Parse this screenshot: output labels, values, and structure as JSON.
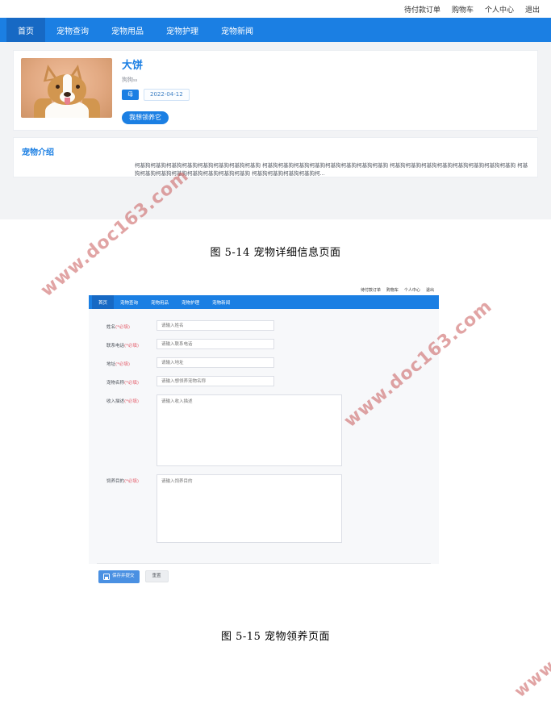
{
  "document": {
    "watermark_text": "www.doc163.com",
    "watermark_color": "#c85a5a"
  },
  "figure1": {
    "caption": "图 5-14  宠物详细信息页面",
    "topbar": {
      "items": [
        {
          "label": "待付款订单"
        },
        {
          "label": "购物车"
        },
        {
          "label": "个人中心"
        },
        {
          "label": "退出"
        }
      ]
    },
    "nav": {
      "items": [
        {
          "label": "首页",
          "active": true
        },
        {
          "label": "宠物查询",
          "active": false
        },
        {
          "label": "宠物用品",
          "active": false
        },
        {
          "label": "宠物护理",
          "active": false
        },
        {
          "label": "宠物新闻",
          "active": false
        }
      ]
    },
    "pet": {
      "name": "大饼",
      "kind": "狗狗",
      "kind_sub": "ss",
      "gender": "母",
      "birthdate": "2022-04-12",
      "adopt_button": "我想领养它",
      "photo_alt": "柯基犬照片"
    },
    "intro": {
      "title": "宠物介绍",
      "body": "柯基狗柯基狗柯基狗柯基狗柯基狗柯基狗柯基狗柯基狗 柯基狗柯基狗柯基狗柯基狗柯基狗柯基狗柯基狗柯基狗 柯基狗柯基狗柯基狗柯基狗柯基狗柯基狗柯基狗柯基狗 柯基狗柯基狗柯基狗柯基狗柯基狗柯基狗柯基狗柯基狗 柯基狗柯基狗柯基狗柯基狗柯..."
    }
  },
  "figure2": {
    "caption": "图 5-15  宠物领养页面",
    "topbar": {
      "items": [
        {
          "label": "待付款订单"
        },
        {
          "label": "购物车"
        },
        {
          "label": "个人中心"
        },
        {
          "label": "退出"
        }
      ]
    },
    "nav": {
      "items": [
        {
          "label": "首页",
          "active": true
        },
        {
          "label": "宠物查询",
          "active": false
        },
        {
          "label": "宠物用品",
          "active": false
        },
        {
          "label": "宠物护理",
          "active": false
        },
        {
          "label": "宠物新闻",
          "active": false
        }
      ]
    },
    "form": {
      "fields": [
        {
          "label": "姓名",
          "required_mark": "(*必填)",
          "placeholder": "请输入姓名",
          "value": "",
          "type": "input"
        },
        {
          "label": "联系电话",
          "required_mark": "(*必填)",
          "placeholder": "请输入联系电话",
          "value": "",
          "type": "input"
        },
        {
          "label": "地址",
          "required_mark": "(*必填)",
          "placeholder": "请输入地址",
          "value": "",
          "type": "input"
        },
        {
          "label": "宠物名称",
          "required_mark": "(*必填)",
          "placeholder": "请输入想领养宠物名称",
          "value": "",
          "type": "input"
        },
        {
          "label": "收入描述",
          "required_mark": "(*必填)",
          "placeholder": "请输入收入描述",
          "value": "",
          "type": "textarea-big"
        },
        {
          "label": "饲养目的",
          "required_mark": "(*必填)",
          "placeholder": "请输入饲养目的",
          "value": "",
          "type": "textarea-small"
        }
      ],
      "actions": {
        "save_label": "保存并提交",
        "save_icon": "floppy-disk-icon",
        "reset_label": "重置"
      }
    }
  }
}
